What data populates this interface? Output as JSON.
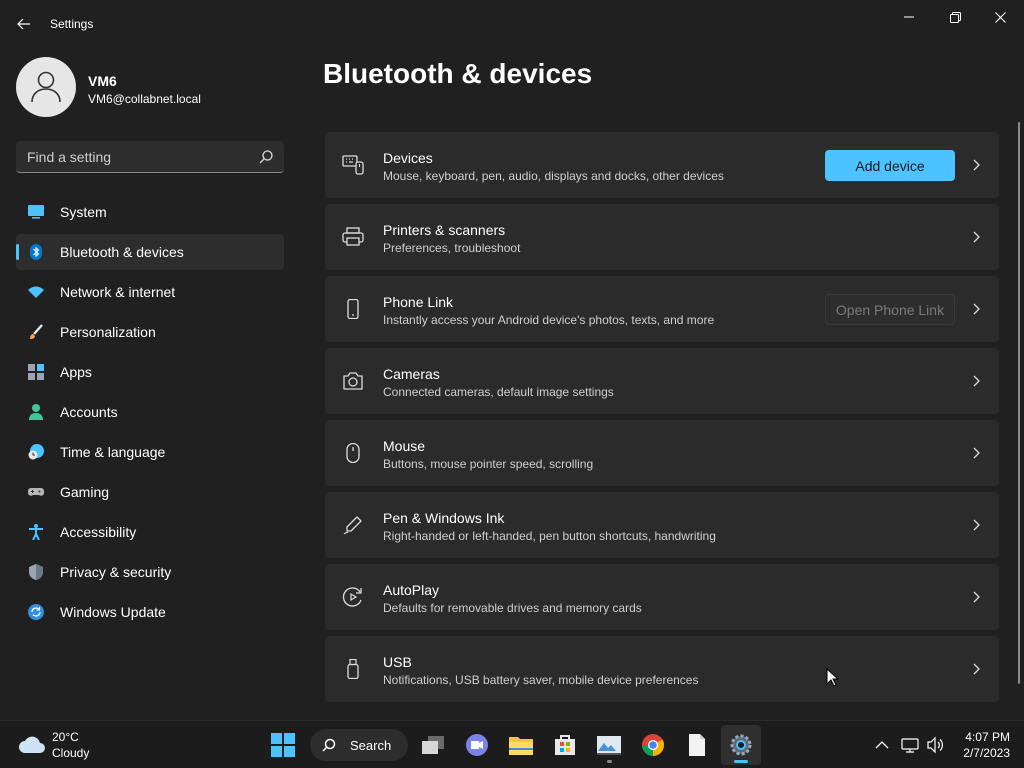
{
  "window": {
    "title": "Settings"
  },
  "user": {
    "name": "VM6",
    "email": "VM6@collabnet.local"
  },
  "search": {
    "placeholder": "Find a setting"
  },
  "nav": {
    "items": [
      {
        "label": "System",
        "icon": "system-icon",
        "color": "#4cc2ff"
      },
      {
        "label": "Bluetooth & devices",
        "icon": "bluetooth-icon",
        "color": "#0078d4"
      },
      {
        "label": "Network & internet",
        "icon": "wifi-icon",
        "color": "#4cc2ff"
      },
      {
        "label": "Personalization",
        "icon": "brush-icon",
        "color": "#f7a35c"
      },
      {
        "label": "Apps",
        "icon": "apps-icon",
        "color": "#9aa4b4"
      },
      {
        "label": "Accounts",
        "icon": "account-icon",
        "color": "#3ec99b"
      },
      {
        "label": "Time & language",
        "icon": "clock-globe-icon",
        "color": "#4cc2ff"
      },
      {
        "label": "Gaming",
        "icon": "gamepad-icon",
        "color": "#b7b7b7"
      },
      {
        "label": "Accessibility",
        "icon": "accessibility-icon",
        "color": "#4cc2ff"
      },
      {
        "label": "Privacy & security",
        "icon": "shield-icon",
        "color": "#9aa4b4"
      },
      {
        "label": "Windows Update",
        "icon": "update-icon",
        "color": "#2f8fe0"
      }
    ],
    "active_index": 1
  },
  "main": {
    "title": "Bluetooth & devices",
    "cards": [
      {
        "title": "Devices",
        "subtitle": "Mouse, keyboard, pen, audio, displays and docks, other devices",
        "icon": "devices-icon",
        "button": "Add device"
      },
      {
        "title": "Printers & scanners",
        "subtitle": "Preferences, troubleshoot",
        "icon": "printer-icon"
      },
      {
        "title": "Phone Link",
        "subtitle": "Instantly access your Android device's photos, texts, and more",
        "icon": "phone-icon",
        "button": "Open Phone Link"
      },
      {
        "title": "Cameras",
        "subtitle": "Connected cameras, default image settings",
        "icon": "camera-icon"
      },
      {
        "title": "Mouse",
        "subtitle": "Buttons, mouse pointer speed, scrolling",
        "icon": "mouse-icon"
      },
      {
        "title": "Pen & Windows Ink",
        "subtitle": "Right-handed or left-handed, pen button shortcuts, handwriting",
        "icon": "pen-icon"
      },
      {
        "title": "AutoPlay",
        "subtitle": "Defaults for removable drives and memory cards",
        "icon": "autoplay-icon"
      },
      {
        "title": "USB",
        "subtitle": "Notifications, USB battery saver, mobile device preferences",
        "icon": "usb-icon"
      }
    ]
  },
  "taskbar": {
    "weather": {
      "temp": "20°C",
      "condition": "Cloudy"
    },
    "search_label": "Search",
    "apps": [
      "start-icon",
      "task-view-icon",
      "teams-chat-icon",
      "file-explorer-icon",
      "microsoft-store-icon",
      "photos-icon",
      "chrome-icon",
      "notepad-icon",
      "settings-icon"
    ],
    "clock": {
      "time": "4:07 PM",
      "date": "2/7/2023"
    }
  },
  "colors": {
    "accent": "#4cc2ff",
    "background": "#202020",
    "card": "#2b2b2b"
  }
}
